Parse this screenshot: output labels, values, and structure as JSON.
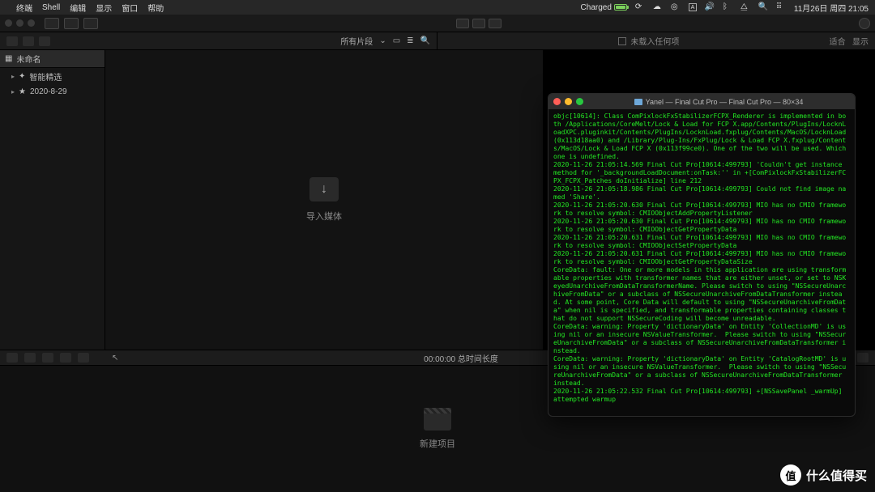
{
  "menubar": {
    "app": "终端",
    "items": [
      "Shell",
      "编辑",
      "显示",
      "窗口",
      "帮助"
    ],
    "battery_label": "Charged",
    "clock": "11月26日 周四  21:05"
  },
  "colbar": {
    "clips_label": "所有片段",
    "viewer_center": "未载入任何项",
    "viewer_right1": "适合",
    "viewer_right2": "显示"
  },
  "sidebar": {
    "header": "未命名",
    "items": [
      "智能精选",
      "2020-8-29"
    ]
  },
  "browser": {
    "import_label": "导入媒体"
  },
  "tlbar": {
    "timecode": "00:00:00 总时间长度"
  },
  "timeline": {
    "new_project": "新建项目"
  },
  "terminal": {
    "title": "Yanel — Final Cut Pro — Final Cut Pro — 80×34",
    "log": "objc[10614]: Class ComPixlockFxStabilizerFCPX_Renderer is implemented in both /Applications/CoreMelt/Lock & Load for FCP X.app/Contents/PlugIns/LocknLoadXPC.pluginkit/Contents/PlugIns/LocknLoad.fxplug/Contents/MacOS/LocknLoad (0x113d18aa0) and /Library/Plug-Ins/FxPlug/Lock & Load FCP X.fxplug/Contents/MacOS/Lock & Load FCP X (0x113f99ce0). One of the two will be used. Which one is undefined.\n2020-11-26 21:05:14.569 Final Cut Pro[10614:499793] 'Couldn't get instance method for '_backgroundLoadDocument:onTask:'' in +[ComPixlockFxStabilizerFCPX_FCPX_Patches doInitialize] line 212\n2020-11-26 21:05:18.986 Final Cut Pro[10614:499793] Could not find image named 'Share'.\n2020-11-26 21:05:20.630 Final Cut Pro[10614:499793] MIO has no CMIO framework to resolve symbol: CMIOObjectAddPropertyListener\n2020-11-26 21:05:20.630 Final Cut Pro[10614:499793] MIO has no CMIO framework to resolve symbol: CMIOObjectGetPropertyData\n2020-11-26 21:05:20.631 Final Cut Pro[10614:499793] MIO has no CMIO framework to resolve symbol: CMIOObjectSetPropertyData\n2020-11-26 21:05:20.631 Final Cut Pro[10614:499793] MIO has no CMIO framework to resolve symbol: CMIOObjectGetPropertyDataSize\nCoreData: fault: One or more models in this application are using transformable properties with transformer names that are either unset, or set to NSKeyedUnarchiveFromDataTransformerName. Please switch to using \"NSSecureUnarchiveFromData\" or a subclass of NSSecureUnarchiveFromDataTransformer instead. At some point, Core Data will default to using \"NSSecureUnarchiveFromData\" when nil is specified, and transformable properties containing classes that do not support NSSecureCoding will become unreadable.\nCoreData: warning: Property 'dictionaryData' on Entity 'CollectionMD' is using nil or an insecure NSValueTransformer.  Please switch to using \"NSSecureUnarchiveFromData\" or a subclass of NSSecureUnarchiveFromDataTransformer instead.\nCoreData: warning: Property 'dictionaryData' on Entity 'CatalogRootMD' is using nil or an insecure NSValueTransformer.  Please switch to using \"NSSecureUnarchiveFromData\" or a subclass of NSSecureUnarchiveFromDataTransformer instead.\n2020-11-26 21:05:22.532 Final Cut Pro[10614:499793] +[NSSavePanel _warmUp] attempted warmup"
  },
  "watermark": {
    "text": "什么值得买",
    "badge": "值"
  }
}
